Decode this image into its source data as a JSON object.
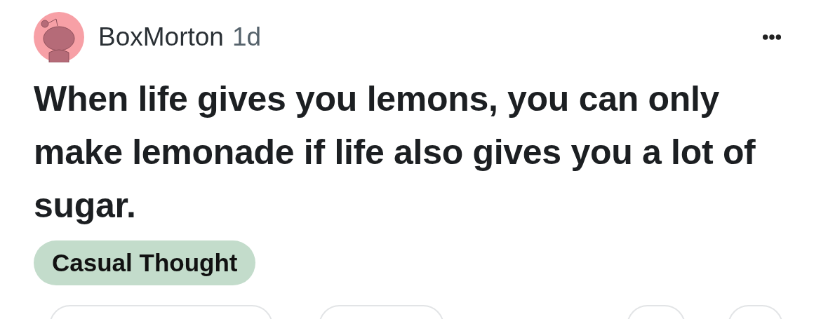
{
  "post": {
    "author": "BoxMorton",
    "age": "1d",
    "title": "When life gives you lemons, you can only make lemonade if life also gives you a lot of sugar.",
    "flair": {
      "label": "Casual Thought",
      "color": "#c3dccb"
    }
  }
}
